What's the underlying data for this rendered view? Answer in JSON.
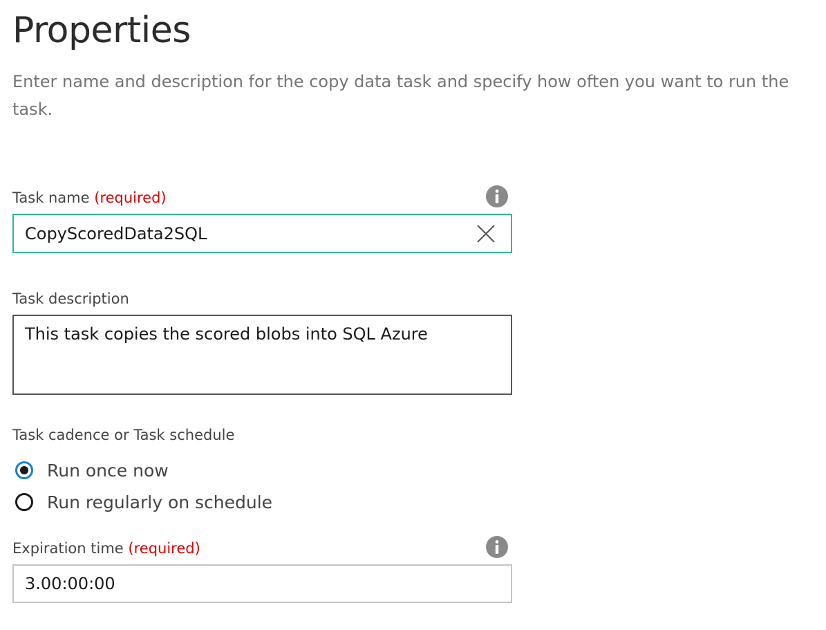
{
  "header": {
    "title": "Properties",
    "subtitle": "Enter name and description for the copy data task and specify how often you want to run the task."
  },
  "task_name": {
    "label": "Task name",
    "required_text": "(required)",
    "value": "CopyScoredData2SQL",
    "info_icon": "info-icon",
    "clear_icon": "close-icon"
  },
  "task_description": {
    "label": "Task description",
    "value": "This task copies the scored blobs into SQL Azure"
  },
  "cadence": {
    "label": "Task cadence or Task schedule",
    "options": [
      {
        "label": "Run once now",
        "selected": true
      },
      {
        "label": "Run regularly on schedule",
        "selected": false
      }
    ]
  },
  "expiration": {
    "label": "Expiration time",
    "required_text": "(required)",
    "value": "3.00:00:00",
    "info_icon": "info-icon"
  },
  "colors": {
    "accent_border": "#2db7a0",
    "required": "#e00000",
    "radio_selected": "#1a7fd6"
  }
}
